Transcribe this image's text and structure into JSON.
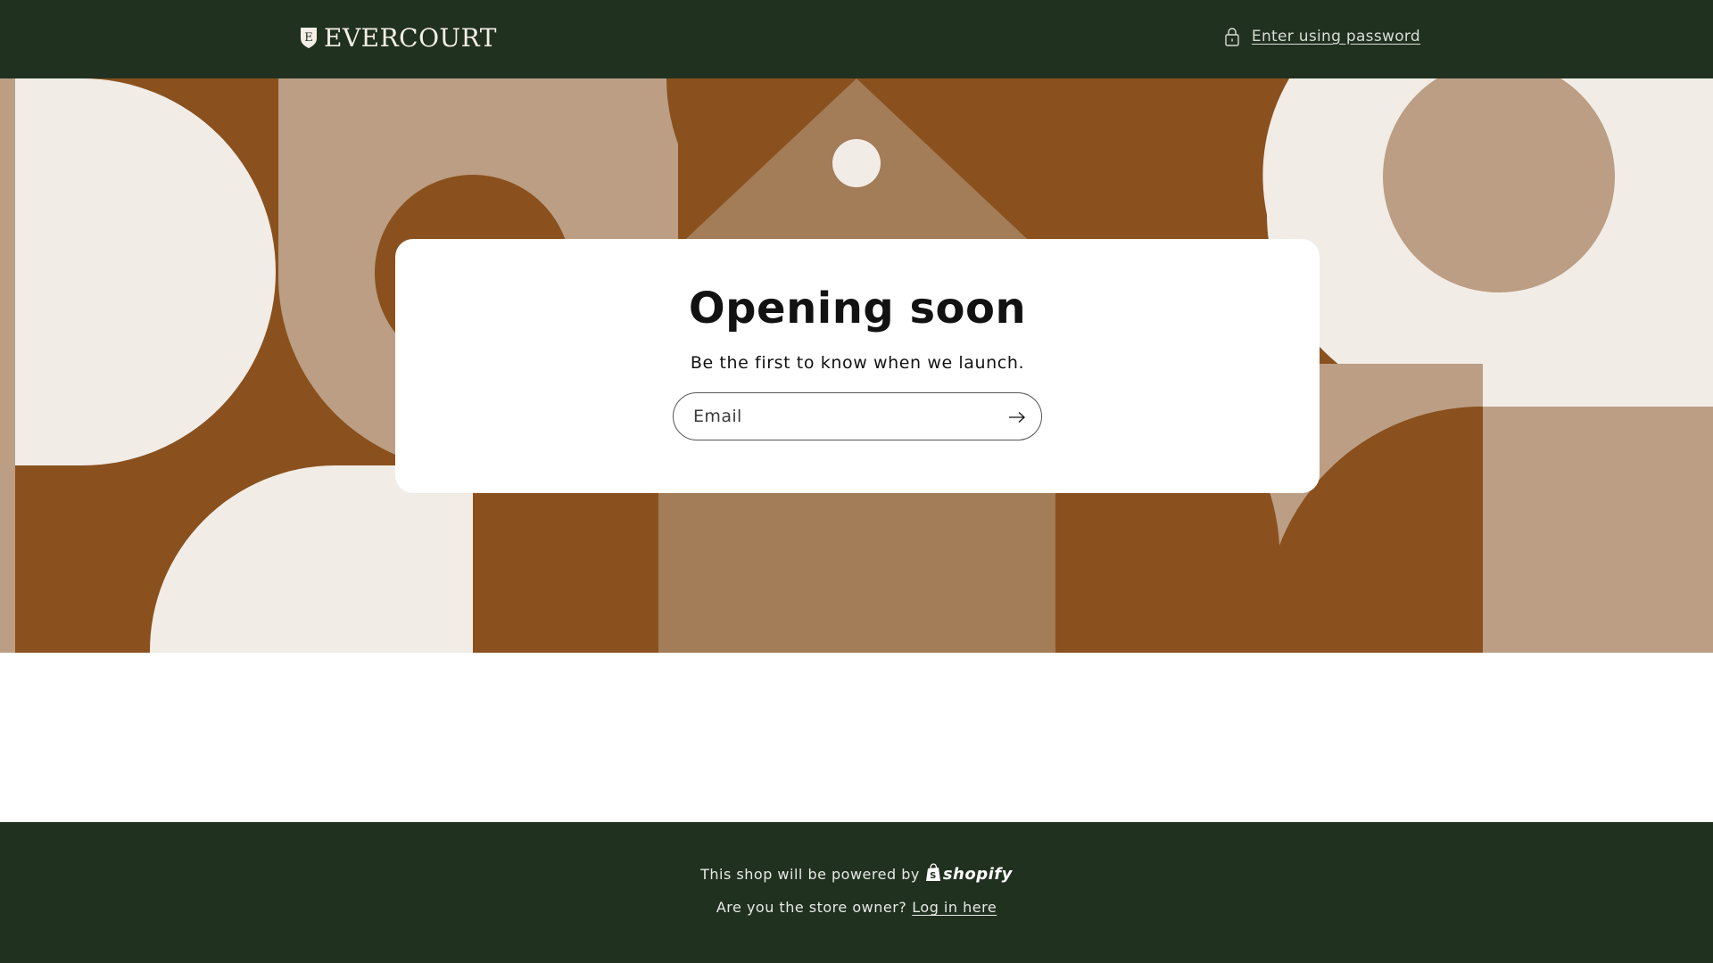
{
  "header": {
    "logo_text": "EVERCOURT",
    "password_link": "Enter using password"
  },
  "card": {
    "title": "Opening soon",
    "subtitle": "Be the first to know when we launch.",
    "email_placeholder": "Email"
  },
  "footer": {
    "powered_text": "This shop will be powered by",
    "shopify_word": "shopify",
    "owner_text": "Are you the store owner?",
    "login_link": "Log in here"
  },
  "colors": {
    "header_bg": "#213120",
    "brown": "#8a511e",
    "tan": "#bb9e83",
    "mid_brown": "#a37c58",
    "cream": "#f1ece6"
  },
  "icons": [
    "shield-logo-icon",
    "lock-icon",
    "arrow-right-icon",
    "shopify-bag-icon"
  ]
}
